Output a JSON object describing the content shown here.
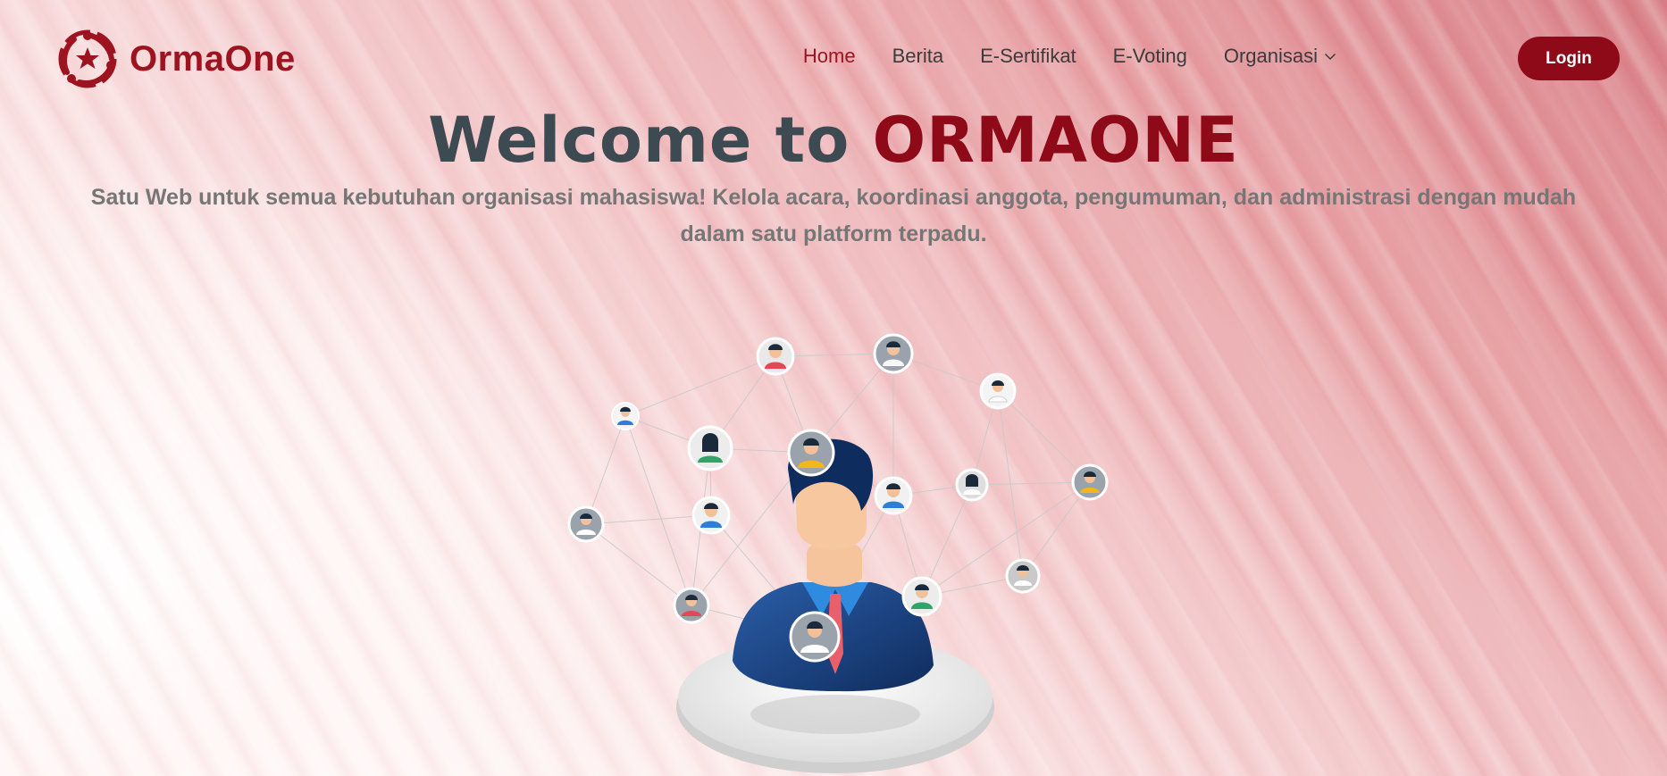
{
  "brand": {
    "name": "OrmaOne",
    "logo_icon": "star-people-circle-logo",
    "color": "#9e1320"
  },
  "nav": {
    "items": [
      {
        "label": "Home",
        "active": true
      },
      {
        "label": "Berita",
        "active": false
      },
      {
        "label": "E-Sertifikat",
        "active": false
      },
      {
        "label": "E-Voting",
        "active": false
      },
      {
        "label": "Organisasi",
        "active": false,
        "has_dropdown": true
      }
    ],
    "login_label": "Login"
  },
  "hero": {
    "title_prefix": "Welcome to ",
    "title_highlight": "ORMAONE",
    "subtitle": "Satu Web untuk semua kebutuhan organisasi mahasiswa! Kelola acara, koordinasi anggota, pengumuman, dan administrasi dengan mudah dalam satu platform terpadu."
  },
  "illustration": {
    "icon": "people-network-illustration"
  },
  "colors": {
    "accent": "#8f0a18",
    "title_gray": "#3e4a52",
    "subtitle_gray": "#767676",
    "nav_text": "#3b3b3b"
  }
}
